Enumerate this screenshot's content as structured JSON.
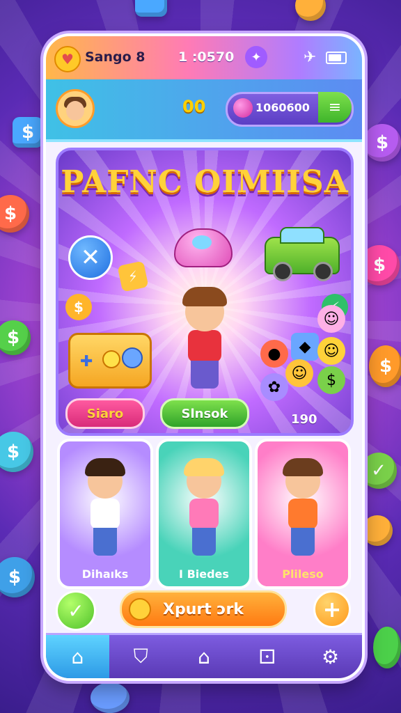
{
  "status_bar": {
    "title": "Sango 8",
    "time": "1 :0570",
    "icons": [
      "heart-icon",
      "gem-icon",
      "airplane-icon",
      "battery-icon"
    ]
  },
  "profile_bar": {
    "coins": "00",
    "currency_value": "1060600",
    "icons": [
      "avatar",
      "gem-icon",
      "menu-icon"
    ]
  },
  "hero": {
    "title": "PAFNC OIMIISA",
    "score": "190",
    "store_button": "Siaro",
    "green_button": "Slnsok"
  },
  "characters": [
    {
      "label": "Dihaıks",
      "bg": "#b58cff",
      "hair": "#3a2212",
      "shirt": "#ffffff",
      "label_color": "#ffffff"
    },
    {
      "label": "I Biedes",
      "bg": "#49d3b9",
      "hair": "#ffd36b",
      "shirt": "#ff7ab8",
      "label_color": "#ffffff"
    },
    {
      "label": "Plileso",
      "bg": "#ff7ec8",
      "hair": "#6b3d1e",
      "shirt": "#ff7a2e",
      "label_color": "#ffe36b"
    }
  ],
  "actions": {
    "main_button": "Xpurt ɔrk"
  },
  "nav": {
    "items": [
      "home-icon",
      "shield-icon",
      "house-icon",
      "dice-icon",
      "gear-icon"
    ],
    "active": "home-icon"
  },
  "colors": {
    "accent": "#ffd23a",
    "primary": "#7d5ce0",
    "success": "#4fc22a"
  }
}
